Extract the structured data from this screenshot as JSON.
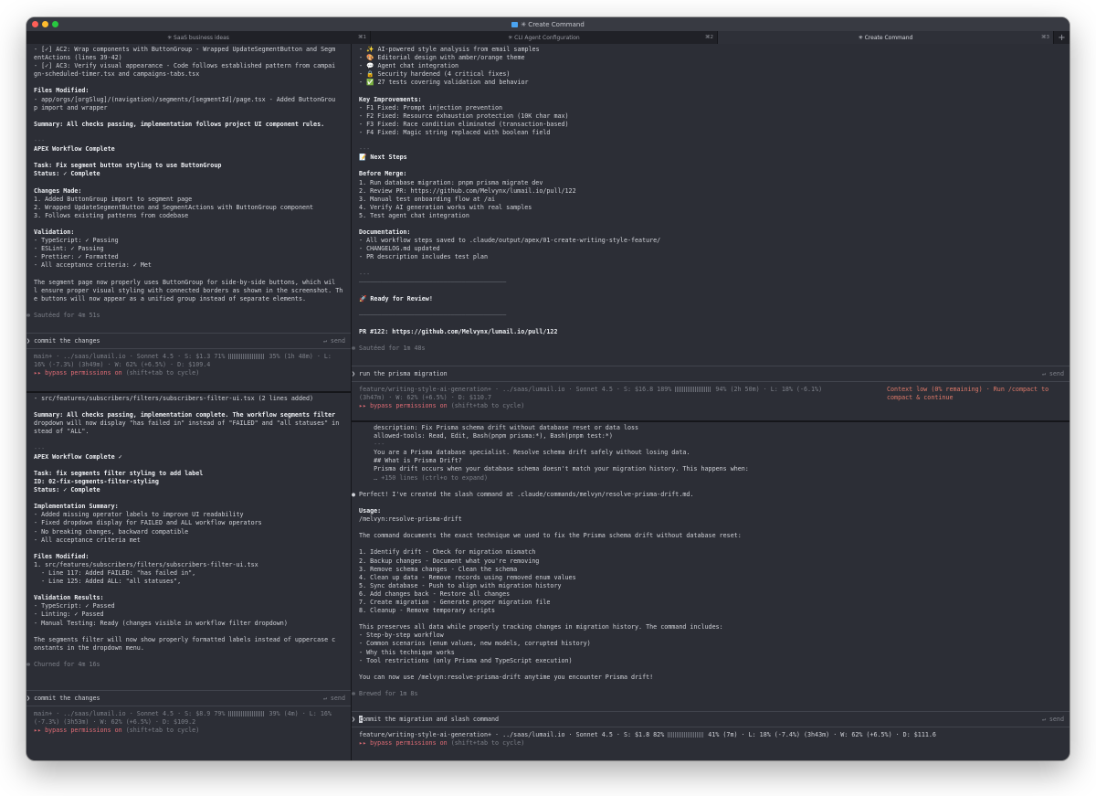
{
  "window": {
    "title": "✳ Create Command"
  },
  "tabs": [
    {
      "label": "✳ SaaS business ideas",
      "shortcut": "⌘1"
    },
    {
      "label": "✳ CLI Agent Configuration",
      "shortcut": "⌘2"
    },
    {
      "label": "✳ Create Command",
      "shortcut": "⌘3"
    }
  ],
  "tab_add": "+",
  "left_top": {
    "lines": [
      "  - [✓] AC2: Wrap components with ButtonGroup - Wrapped UpdateSegmentButton and Segm",
      "  entActions (lines 39-42)",
      "  - [✓] AC3: Verify visual appearance - Code follows established pattern from campai",
      "  gn-scheduled-timer.tsx and campaigns-tabs.tsx",
      "",
      "  Files Modified:",
      "  - app/orgs/[orgSlug]/(navigation)/segments/[segmentId]/page.tsx - Added ButtonGrou",
      "  p import and wrapper",
      "",
      "  Summary: All checks passing, implementation follows project UI component rules.",
      "",
      "  ---",
      "  APEX Workflow Complete",
      "",
      "  Task: Fix segment button styling to use ButtonGroup",
      "  Status: ✓ Complete",
      "",
      "  Changes Made:",
      "  1. Added ButtonGroup import to segment page",
      "  2. Wrapped UpdateSegmentButton and SegmentActions with ButtonGroup component",
      "  3. Follows existing patterns from codebase",
      "",
      "  Validation:",
      "  - TypeScript: ✓ Passing",
      "  - ESLint: ✓ Passing",
      "  - Prettier: ✓ Formatted",
      "  - All acceptance criteria: ✓ Met",
      "",
      "  The segment page now properly uses ButtonGroup for side-by-side buttons, which wil",
      "  l ensure proper visual styling with connected borders as shown in the screenshot. Th",
      "  e buttons will now appear as a unified group instead of separate elements.",
      "",
      "✻ Sautéed for 4m 51s"
    ],
    "prompt": "commit the changes",
    "send": "↵ send",
    "status1": "  main+ · ../saas/lumail.io · Sonnet 4.5 · S: $1.3 71%",
    "status1b": "35% (1h 48m) · L:",
    "status2": "  16% (-7.3%) (3h49m) · W: 62% (+6.5%) · D: $109.4",
    "bypass": "  ▸▸ bypass permissions on",
    "bypass_hint": " (shift+tab to cycle)"
  },
  "left_bottom": {
    "lines": [
      "  - src/features/subscribers/filters/subscribers-filter-ui.tsx (2 lines added)",
      "",
      "  Summary: All checks passing, implementation complete. The workflow segments filter",
      "  dropdown will now display \"has failed in\" instead of \"FAILED\" and \"all statuses\" in",
      "  stead of \"ALL\".",
      "",
      "  ---",
      "  APEX Workflow Complete ✓",
      "",
      "  Task: fix segments filter styling to add label",
      "  ID: 02-fix-segments-filter-styling",
      "  Status: ✓ Complete",
      "",
      "  Implementation Summary:",
      "  - Added missing operator labels to improve UI readability",
      "  - Fixed dropdown display for FAILED and ALL workflow operators",
      "  - No breaking changes, backward compatible",
      "  - All acceptance criteria met",
      "",
      "  Files Modified:",
      "  1. src/features/subscribers/filters/subscribers-filter-ui.tsx",
      "    - Line 117: Added FAILED: \"has failed in\",",
      "    - Line 125: Added ALL: \"all statuses\",",
      "",
      "  Validation Results:",
      "  - TypeScript: ✓ Passed",
      "  - Linting: ✓ Passed",
      "  - Manual Testing: Ready (changes visible in workflow filter dropdown)",
      "",
      "  The segments filter will now show properly formatted labels instead of uppercase c",
      "  onstants in the dropdown menu.",
      "",
      "✻ Churned for 4m 16s"
    ],
    "prompt": "commit the changes",
    "send": "↵ send",
    "status1": "  main+ · ../saas/lumail.io · Sonnet 4.5 · S: $8.9 79%",
    "status1b": "39% (4m) · L: 16%",
    "status2": "  (-7.3%) (3h53m) · W: 62% (+6.5%) · D: $109.2",
    "bypass": "  ▸▸ bypass permissions on",
    "bypass_hint": " (shift+tab to cycle)"
  },
  "right_top": {
    "lines": [
      "  - ✨ AI-powered style analysis from email samples",
      "  - 🎨 Editorial design with amber/orange theme",
      "  - 💬 Agent chat integration",
      "  - 🔒 Security hardened (4 critical fixes)",
      "  - ✅ 27 tests covering validation and behavior",
      "",
      "  Key Improvements:",
      "  - F1 Fixed: Prompt injection prevention",
      "  - F2 Fixed: Resource exhaustion protection (10K char max)",
      "  - F3 Fixed: Race condition eliminated (transaction-based)",
      "  - F4 Fixed: Magic string replaced with boolean field",
      "",
      "  ---",
      "  📝 Next Steps",
      "",
      "  Before Merge:",
      "  1. Run database migration: pnpm prisma migrate dev",
      "  2. Review PR: https://github.com/Melvynx/lumail.io/pull/122",
      "  3. Manual test onboarding flow at /ai",
      "  4. Verify AI generation works with real samples",
      "  5. Test agent chat integration",
      "",
      "  Documentation:",
      "  - All workflow steps saved to .claude/output/apex/01-create-writing-style-feature/",
      "  - CHANGELOG.md updated",
      "  - PR description includes test plan",
      "",
      "  ---",
      "  ────────────────────────────────────────",
      "",
      "  🚀 Ready for Review!",
      "",
      "  ────────────────────────────────────────",
      "",
      "  PR #122: https://github.com/Melvynx/lumail.io/pull/122",
      "",
      "✻ Sautéed for 1m 48s"
    ],
    "prompt": "run the prisma migration",
    "send": "↵ send",
    "status1": "  feature/writing-style-ai-generation+ · ../saas/lumail.io · Sonnet 4.5 · S: $16.8 189%",
    "status1b": "94% (2h 50m) · L: 18% (-6.1%)",
    "status2": "  (3h47m) · W: 62% (+6.5%) · D: $110.7",
    "warning1": "Context low (0% remaining) · Run /compact to",
    "warning2": "compact & continue",
    "bypass": "  ▸▸ bypass permissions on",
    "bypass_hint": " (shift+tab to cycle)"
  },
  "right_bottom": {
    "lines": [
      "      description: Fix Prisma schema drift without database reset or data loss",
      "      allowed-tools: Read, Edit, Bash(pnpm prisma:*), Bash(pnpm test:*)",
      "      ---",
      "      You are a Prisma database specialist. Resolve schema drift safely without losing data.",
      "      ## What is Prisma Drift?",
      "      Prisma drift occurs when your database schema doesn't match your migration history. This happens when:",
      "      … +150 lines (ctrl+o to expand)",
      "",
      "● Perfect! I've created the slash command at .claude/commands/melvyn/resolve-prisma-drift.md.",
      "",
      "  Usage:",
      "  /melvyn:resolve-prisma-drift",
      "",
      "  The command documents the exact technique we used to fix the Prisma schema drift without database reset:",
      "",
      "  1. Identify drift - Check for migration mismatch",
      "  2. Backup changes - Document what you're removing",
      "  3. Remove schema changes - Clean the schema",
      "  4. Clean up data - Remove records using removed enum values",
      "  5. Sync database - Push to align with migration history",
      "  6. Add changes back - Restore all changes",
      "  7. Create migration - Generate proper migration file",
      "  8. Cleanup - Remove temporary scripts",
      "",
      "  This preserves all data while properly tracking changes in migration history. The command includes:",
      "  - Step-by-step workflow",
      "  - Common scenarios (enum values, new models, corrupted history)",
      "  - Why this technique works",
      "  - Tool restrictions (only Prisma and TypeScript execution)",
      "",
      "  You can now use /melvyn:resolve-prisma-drift anytime you encounter Prisma drift!",
      "",
      "✻ Brewed for 1m 8s"
    ],
    "prompt_first": "c",
    "prompt_rest": "ommit the migration and slash command",
    "send": "↵ send",
    "status1": "  feature/writing-style-ai-generation+ · ../saas/lumail.io · Sonnet 4.5 · S: $1.8 82%",
    "status1b": "41% (7m) · L: 18% (-7.4%) (3h43m) · W: 62% (+6.5%) · D: $111.6",
    "bypass": "  ▸▸ bypass permissions on",
    "bypass_hint": " (shift+tab to cycle)"
  }
}
